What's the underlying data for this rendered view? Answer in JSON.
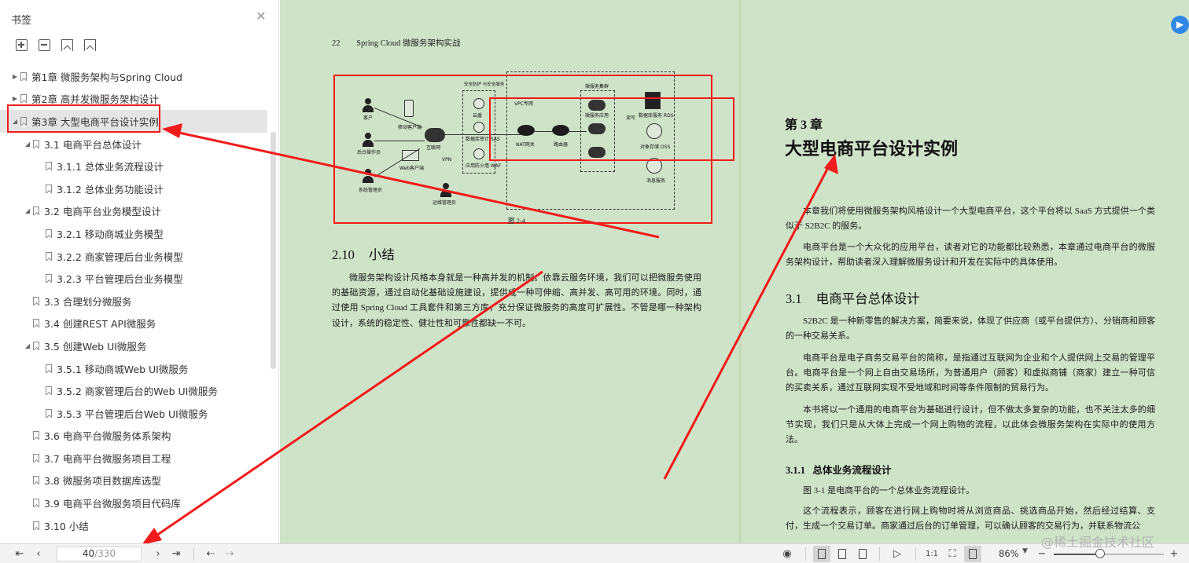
{
  "sidebar": {
    "title": "书签",
    "items": [
      {
        "label": "第1章  微服务架构与Spring Cloud",
        "level": 0,
        "toggle": "collapsed"
      },
      {
        "label": "第2章  高并发微服务架构设计",
        "level": 0,
        "toggle": "collapsed"
      },
      {
        "label": "第3章  大型电商平台设计实例",
        "level": 0,
        "toggle": "expanded",
        "selected": true
      },
      {
        "label": "3.1 电商平台总体设计",
        "level": 1,
        "toggle": "expanded"
      },
      {
        "label": "3.1.1  总体业务流程设计",
        "level": 2,
        "toggle": "none"
      },
      {
        "label": "3.1.2  总体业务功能设计",
        "level": 2,
        "toggle": "none"
      },
      {
        "label": "3.2 电商平台业务模型设计",
        "level": 1,
        "toggle": "expanded"
      },
      {
        "label": "3.2.1  移动商城业务模型",
        "level": 2,
        "toggle": "none"
      },
      {
        "label": "3.2.2  商家管理后台业务模型",
        "level": 2,
        "toggle": "none"
      },
      {
        "label": "3.2.3  平台管理后台业务模型",
        "level": 2,
        "toggle": "none"
      },
      {
        "label": "3.3  合理划分微服务",
        "level": 1,
        "toggle": "none"
      },
      {
        "label": "3.4  创建REST API微服务",
        "level": 1,
        "toggle": "none"
      },
      {
        "label": "3.5  创建Web UI微服务",
        "level": 1,
        "toggle": "expanded"
      },
      {
        "label": "3.5.1  移动商城Web UI微服务",
        "level": 2,
        "toggle": "none"
      },
      {
        "label": "3.5.2  商家管理后台的Web UI微服务",
        "level": 2,
        "toggle": "none"
      },
      {
        "label": "3.5.3  平台管理后台Web UI微服务",
        "level": 2,
        "toggle": "none"
      },
      {
        "label": "3.6 电商平台微服务体系架构",
        "level": 1,
        "toggle": "none"
      },
      {
        "label": "3.7 电商平台微服务项目工程",
        "level": 1,
        "toggle": "none"
      },
      {
        "label": "3.8  微服务项目数据库选型",
        "level": 1,
        "toggle": "none"
      },
      {
        "label": "3.9 电商平台微服务项目代码库",
        "level": 1,
        "toggle": "none"
      },
      {
        "label": "3.10  小结",
        "level": 1,
        "toggle": "none"
      }
    ]
  },
  "left_page": {
    "page_number": "22",
    "running_title": "Spring Cloud 微服务架构实战",
    "figure": {
      "caption": "图 2-4",
      "nodes": [
        "客户",
        "移动客户端",
        "后台操作员",
        "Web客户端",
        "互联网",
        "VPN",
        "系统管理员",
        "运维管理员",
        "安全防护 与安全服务",
        "云盾",
        "数据库审计 SAS",
        "应用防火墙 WAF",
        "VPC专网",
        "NAT网关",
        "路由器",
        "微服务集群",
        "微服务应用",
        "读写",
        "数据库服务 RDS",
        "对象存储 OSS",
        "消息服务"
      ]
    },
    "section": {
      "number": "2.10",
      "title": "小结"
    },
    "paragraph": "微服务架构设计风格本身就是一种高并发的机制。依靠云服务环境，我们可以把微服务使用的基础资源，通过自动化基础设施建设，提供成一种可伸缩、高并发、高可用的环境。同时，通过使用 Spring Cloud 工具套件和第三方库，充分保证微服务的高度可扩展性。不管是哪一种架构设计，系统的稳定性、健壮性和可靠性都缺一不可。"
  },
  "right_page": {
    "chapter_number": "第 3 章",
    "chapter_title": "大型电商平台设计实例",
    "intro": [
      "本章我们将使用微服务架构风格设计一个大型电商平台，这个平台将以 SaaS 方式提供一个类似于 S2B2C 的服务。",
      "电商平台是一个大众化的应用平台，读者对它的功能都比较熟悉，本章通过电商平台的微服务架构设计，帮助读者深入理解微服务设计和开发在实际中的具体使用。"
    ],
    "section": {
      "number": "3.1",
      "title": "电商平台总体设计"
    },
    "section_paras": [
      "S2B2C 是一种新零售的解决方案，简要来说，体现了供应商（或平台提供方）、分销商和顾客的一种交易关系。",
      "电商平台是电子商务交易平台的简称，是指通过互联网为企业和个人提供网上交易的管理平台。电商平台是一个网上自由交易场所，为普通用户（顾客）和虚拟商铺（商家）建立一种可信的买卖关系，通过互联网实现不受地域和时间等条件限制的贸易行为。",
      "本书将以一个通用的电商平台为基础进行设计，但不做太多复杂的功能，也不关注太多的细节实现，我们只是从大体上完成一个网上购物的流程，以此体会微服务架构在实际中的使用方法。"
    ],
    "subsection": {
      "number": "3.1.1",
      "title": "总体业务流程设计"
    },
    "sub_paras": [
      "图 3-1 是电商平台的一个总体业务流程设计。",
      "这个流程表示，顾客在进行网上购物时将从浏览商品、挑选商品开始，然后经过结算、支付，生成一个交易订单。商家通过后台的订单管理，可以确认顾客的交易行为，并联系物流公"
    ]
  },
  "statusbar": {
    "current_page": "40",
    "total_pages": "/330",
    "zoom": "86%",
    "zoom_level": 0.42
  },
  "watermark": "@稀土掘金技术社区",
  "colors": {
    "annotation_red": "#f21b1b",
    "page_bg": "#cfe3c8",
    "accent_blue": "#2f88e8"
  }
}
